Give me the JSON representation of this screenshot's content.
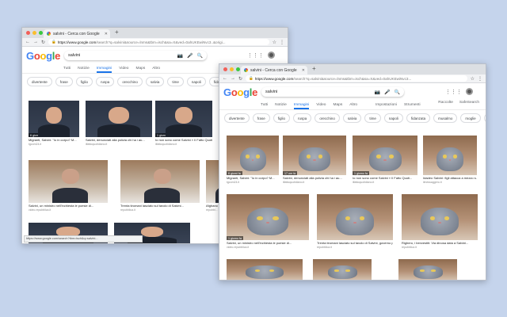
{
  "back_window": {
    "tab_title": "salvini - Cerca con Google",
    "url_domain": "https://www.google.com",
    "url_rest": "/search?q=salvini&source=lnms&tbm=isch&sa=X&ved=0ahUKEwiNvc3..&origi...",
    "search_query": "salvini",
    "tabs": [
      "Tutti",
      "Notizie",
      "Immagini",
      "Video",
      "Maps",
      "Altro"
    ],
    "tabs_right": [
      "Impostazioni",
      "Strumenti"
    ],
    "chips": [
      "divertente",
      "frase",
      "figlio",
      "ruspa",
      "orecchino",
      "salvia",
      "time",
      "napoli",
      "fidanzata"
    ],
    "results": [
      {
        "src": "6 giorni fa",
        "title": "Migranti, Salvini: \"Io in corpo? M...",
        "domain": "tgcom24.it"
      },
      {
        "src": "",
        "title": "Salvini, denunciati alla polizia chi ha i au...",
        "domain": "ilfattoquotidiano.it"
      },
      {
        "src": "1 giorno fa",
        "title": "Io non sono come Salvini » Il Fatto Quoti...",
        "domain": "ilfattoquotidiano.it"
      },
      {
        "src": "",
        "title": "Salvini, un ministro nell'inchiesta le poesie di...",
        "domain": "video.repubblica.it"
      },
      {
        "src": "",
        "title": "Trenta tiromani lasciato sul tavolo di Salvini...",
        "domain": "repubblica.it"
      },
      {
        "src": "",
        "title": "Afghano",
        "domain": "repubbl..."
      }
    ],
    "status_url": "https://www.google.com/search?tbm=isch&q=salvini..."
  },
  "front_window": {
    "tab_title": "salvini - Cerca con Google",
    "url_domain": "https://www.google.com",
    "url_rest": "/search?q=salvini&source=lnms&tbm=isch&sa=X&ved=0ahUKEwiNvc3...",
    "search_query": "salvini",
    "tabs": [
      "Tutti",
      "Notizie",
      "Immagini",
      "Video",
      "Maps",
      "Altro"
    ],
    "tabs_right": [
      "Impostazioni",
      "Strumenti"
    ],
    "header_right": [
      "Raccolte",
      "SafeSearch"
    ],
    "chips": [
      "divertente",
      "frase",
      "figlio",
      "ruspa",
      "orecchino",
      "salvia",
      "time",
      "napoli",
      "fidanzata",
      "musalmo",
      "moglie",
      "lega"
    ],
    "results_row1": [
      {
        "src": "6 giorni fa",
        "title": "Migranti, Salvini: \"Io in corpo? M...",
        "domain": "tgcom24.it"
      },
      {
        "src": "17 ore fa",
        "title": "Salvini, denunciati alla polizia chi ha i au...",
        "domain": "ilfattoquotidiano.it"
      },
      {
        "src": "1 giorno fa",
        "title": "Io non sono come Salvini » Il Fatto Quoti...",
        "domain": "ilfattoquotidiano.it"
      },
      {
        "src": "",
        "title": "Idadeo Salvini: figli attacca a mezzo s...",
        "domain": "ilmessaggero.it"
      }
    ],
    "results_row2": [
      {
        "src": "1 giorno fa",
        "title": "Salvini, un ministro nell'inchiesta le poesie di...",
        "domain": "video.repubblica.it"
      },
      {
        "src": "",
        "title": "Trenta tiromani lasciato sul tavolo di Salvini, governo pre...",
        "domain": "repubblica.it"
      },
      {
        "src": "",
        "title": "Righero, i benvestiti: Via dinosa data a Salvini...",
        "domain": "repubblica.it"
      }
    ]
  }
}
